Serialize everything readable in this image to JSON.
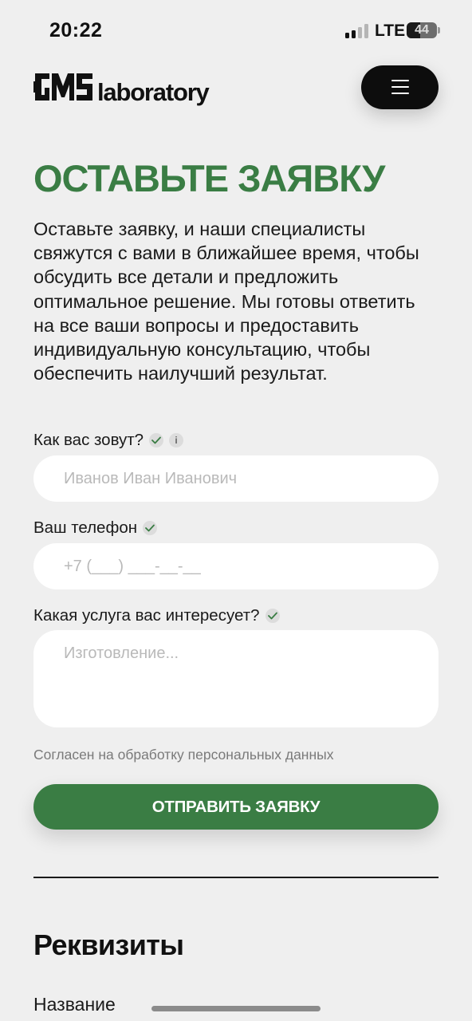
{
  "status_bar": {
    "time": "20:22",
    "network": "LTE",
    "battery": "44",
    "battery_level_percent": 44
  },
  "header": {
    "logo_word": "laboratory",
    "menu_icon": "hamburger-icon"
  },
  "main": {
    "title": "ОСТАВЬТЕ ЗАЯВКУ",
    "intro": "Оставьте заявку, и наши специалисты свяжутся с вами в ближайшее время, чтобы обсудить все детали и предложить оптимальное решение. Мы готовы ответить на все ваши вопросы и предоставить индивидуальную консультацию, чтобы обеспечить наилучший результат."
  },
  "form": {
    "name_label": "Как вас зовут?",
    "name_placeholder": "Иванов Иван Иванович",
    "name_info_glyph": "i",
    "phone_label": "Ваш телефон",
    "phone_placeholder": "+7 (___) ___-__-__",
    "service_label": "Какая услуга вас интересует?",
    "service_placeholder": "Изготовление...",
    "consent_text": "Согласен на обработку персональных данных",
    "submit_label": "ОТПРАВИТЬ ЗАЯВКУ"
  },
  "requisites": {
    "title": "Реквизиты",
    "first_label": "Название"
  },
  "colors": {
    "accent_green": "#3a7d44",
    "background": "#efefef",
    "field_background": "#ffffff",
    "dark": "#0d0d0d"
  }
}
